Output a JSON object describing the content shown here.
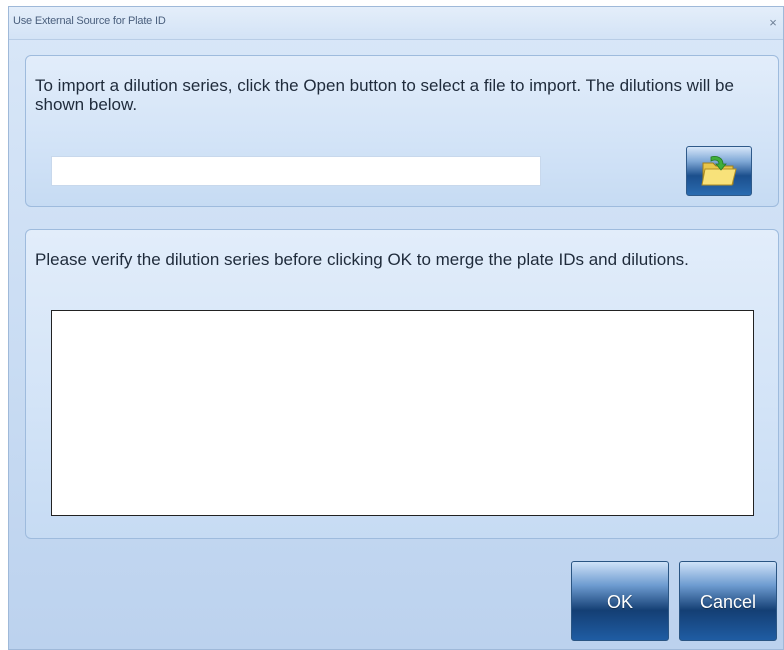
{
  "window": {
    "title": "Use External Source for Plate ID",
    "close_glyph": "×"
  },
  "import_section": {
    "instruction": "To import a dilution series, click the Open button to select a file to import. The dilutions will be shown below.",
    "file_path_value": "",
    "open_button_icon": "open-folder-icon"
  },
  "verify_section": {
    "instruction": "Please verify the dilution series before clicking OK to merge the plate IDs and dilutions.",
    "dilution_items": []
  },
  "buttons": {
    "ok_label": "OK",
    "cancel_label": "Cancel"
  },
  "colors": {
    "accent_button_dark": "#143f74",
    "dialog_background": "#c9dcf3"
  }
}
